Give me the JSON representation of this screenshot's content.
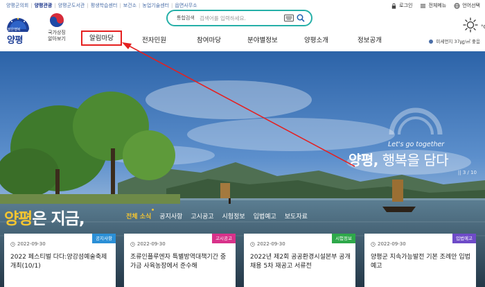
{
  "top_links": [
    "양평군의회",
    "양평관광",
    "양평군도서관",
    "평생학습센터",
    "보건소",
    "농업기술센터",
    "읍면사무소"
  ],
  "top_links_active_index": 1,
  "util": {
    "login": "로그인",
    "sitemap": "전체메뉴",
    "language": "언어선택"
  },
  "logo": {
    "arc_text": "맑은행복",
    "name": "양평"
  },
  "national_agenda": {
    "line1": "국가상징",
    "line2": "알아보기"
  },
  "search": {
    "category": "통합검색",
    "placeholder": "검색어를 입력하세요."
  },
  "weather": {
    "unit": "°C",
    "dust_label": "미세먼지",
    "dust_value": "37㎍/㎥",
    "dust_grade": "좋음"
  },
  "nav": [
    "알림마당",
    "전자민원",
    "참여마당",
    "분야별정보",
    "양평소개",
    "정보공개"
  ],
  "nav_highlight_index": 0,
  "hero": {
    "slogan_small": "Let's go together",
    "slogan_bold": "양평,",
    "slogan_rest": "행복을 담다",
    "counter": "|| 3 / 10"
  },
  "news": {
    "title_hl": "양평",
    "title_rest": "은 지금,",
    "tabs": [
      "전체 소식",
      "공지사항",
      "고시공고",
      "시험정보",
      "입법예고",
      "보도자료"
    ],
    "active_tab": 0,
    "cards": [
      {
        "badge": "공지사항",
        "badge_color": "#2b8fd6",
        "date": "2022-09-30",
        "title": "2022 페스티벌 다다:양강섬예술축제 개최(10/1)"
      },
      {
        "badge": "고시공고",
        "badge_color": "#d8328a",
        "date": "2022-09-30",
        "title": "조류인플루엔자 특별방역대책기간 중 가금 사육농장에서 준수해"
      },
      {
        "badge": "시험정보",
        "badge_color": "#2ea84a",
        "date": "2022-09-30",
        "title": "2022년 제2회 공공환경시설본부 공개채용 5차 재공고 서류전"
      },
      {
        "badge": "입법예고",
        "badge_color": "#6e4bc8",
        "date": "2022-09-30",
        "title": "양평군 지속가능발전 기본 조례안 입법예고"
      }
    ]
  },
  "colors": {
    "brand": "#1e3f96",
    "search_border": "#26b0a8",
    "accent": "#f4c531",
    "highlight_box": "#e52020"
  }
}
